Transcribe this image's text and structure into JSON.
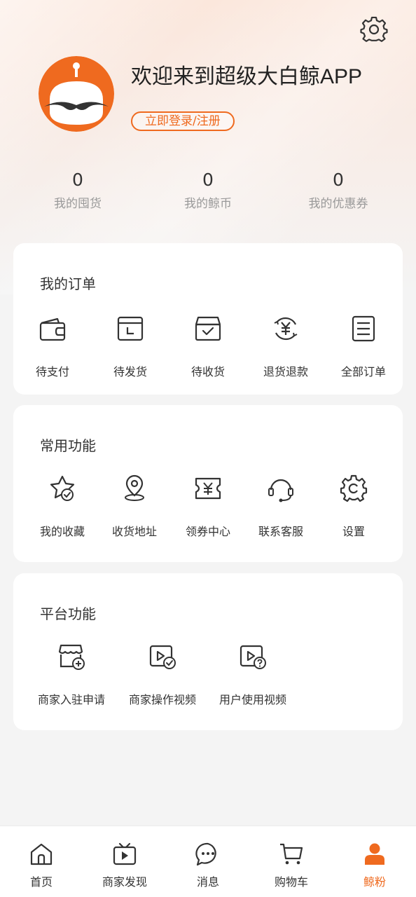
{
  "header": {
    "welcome_text": "欢迎来到超级大白鲸APP",
    "login_label": "立即登录/注册"
  },
  "stats": [
    {
      "value": "0",
      "label": "我的囤货"
    },
    {
      "value": "0",
      "label": "我的鲸币"
    },
    {
      "value": "0",
      "label": "我的优惠券"
    }
  ],
  "orders": {
    "title": "我的订单",
    "items": [
      {
        "label": "待支付",
        "icon": "wallet-icon"
      },
      {
        "label": "待发货",
        "icon": "package-icon"
      },
      {
        "label": "待收货",
        "icon": "box-check-icon"
      },
      {
        "label": "退货退款",
        "icon": "refund-icon"
      },
      {
        "label": "全部订单",
        "icon": "order-list-icon"
      }
    ]
  },
  "common": {
    "title": "常用功能",
    "items": [
      {
        "label": "我的收藏",
        "icon": "star-check-icon"
      },
      {
        "label": "收货地址",
        "icon": "location-icon"
      },
      {
        "label": "领券中心",
        "icon": "coupon-icon"
      },
      {
        "label": "联系客服",
        "icon": "headset-icon"
      },
      {
        "label": "设置",
        "icon": "gear-icon"
      }
    ]
  },
  "platform": {
    "title": "平台功能",
    "items": [
      {
        "label": "商家入驻申请",
        "icon": "store-add-icon"
      },
      {
        "label": "商家操作视频",
        "icon": "video-check-icon"
      },
      {
        "label": "用户使用视频",
        "icon": "video-help-icon"
      }
    ]
  },
  "tabbar": [
    {
      "label": "首页",
      "icon": "home-icon",
      "active": false
    },
    {
      "label": "商家发现",
      "icon": "tv-icon",
      "active": false
    },
    {
      "label": "消息",
      "icon": "chat-icon",
      "active": false
    },
    {
      "label": "购物车",
      "icon": "cart-icon",
      "active": false
    },
    {
      "label": "鲸粉",
      "icon": "user-icon",
      "active": true
    }
  ],
  "colors": {
    "accent": "#ef6a1f",
    "text": "#333333",
    "muted": "#999999"
  }
}
